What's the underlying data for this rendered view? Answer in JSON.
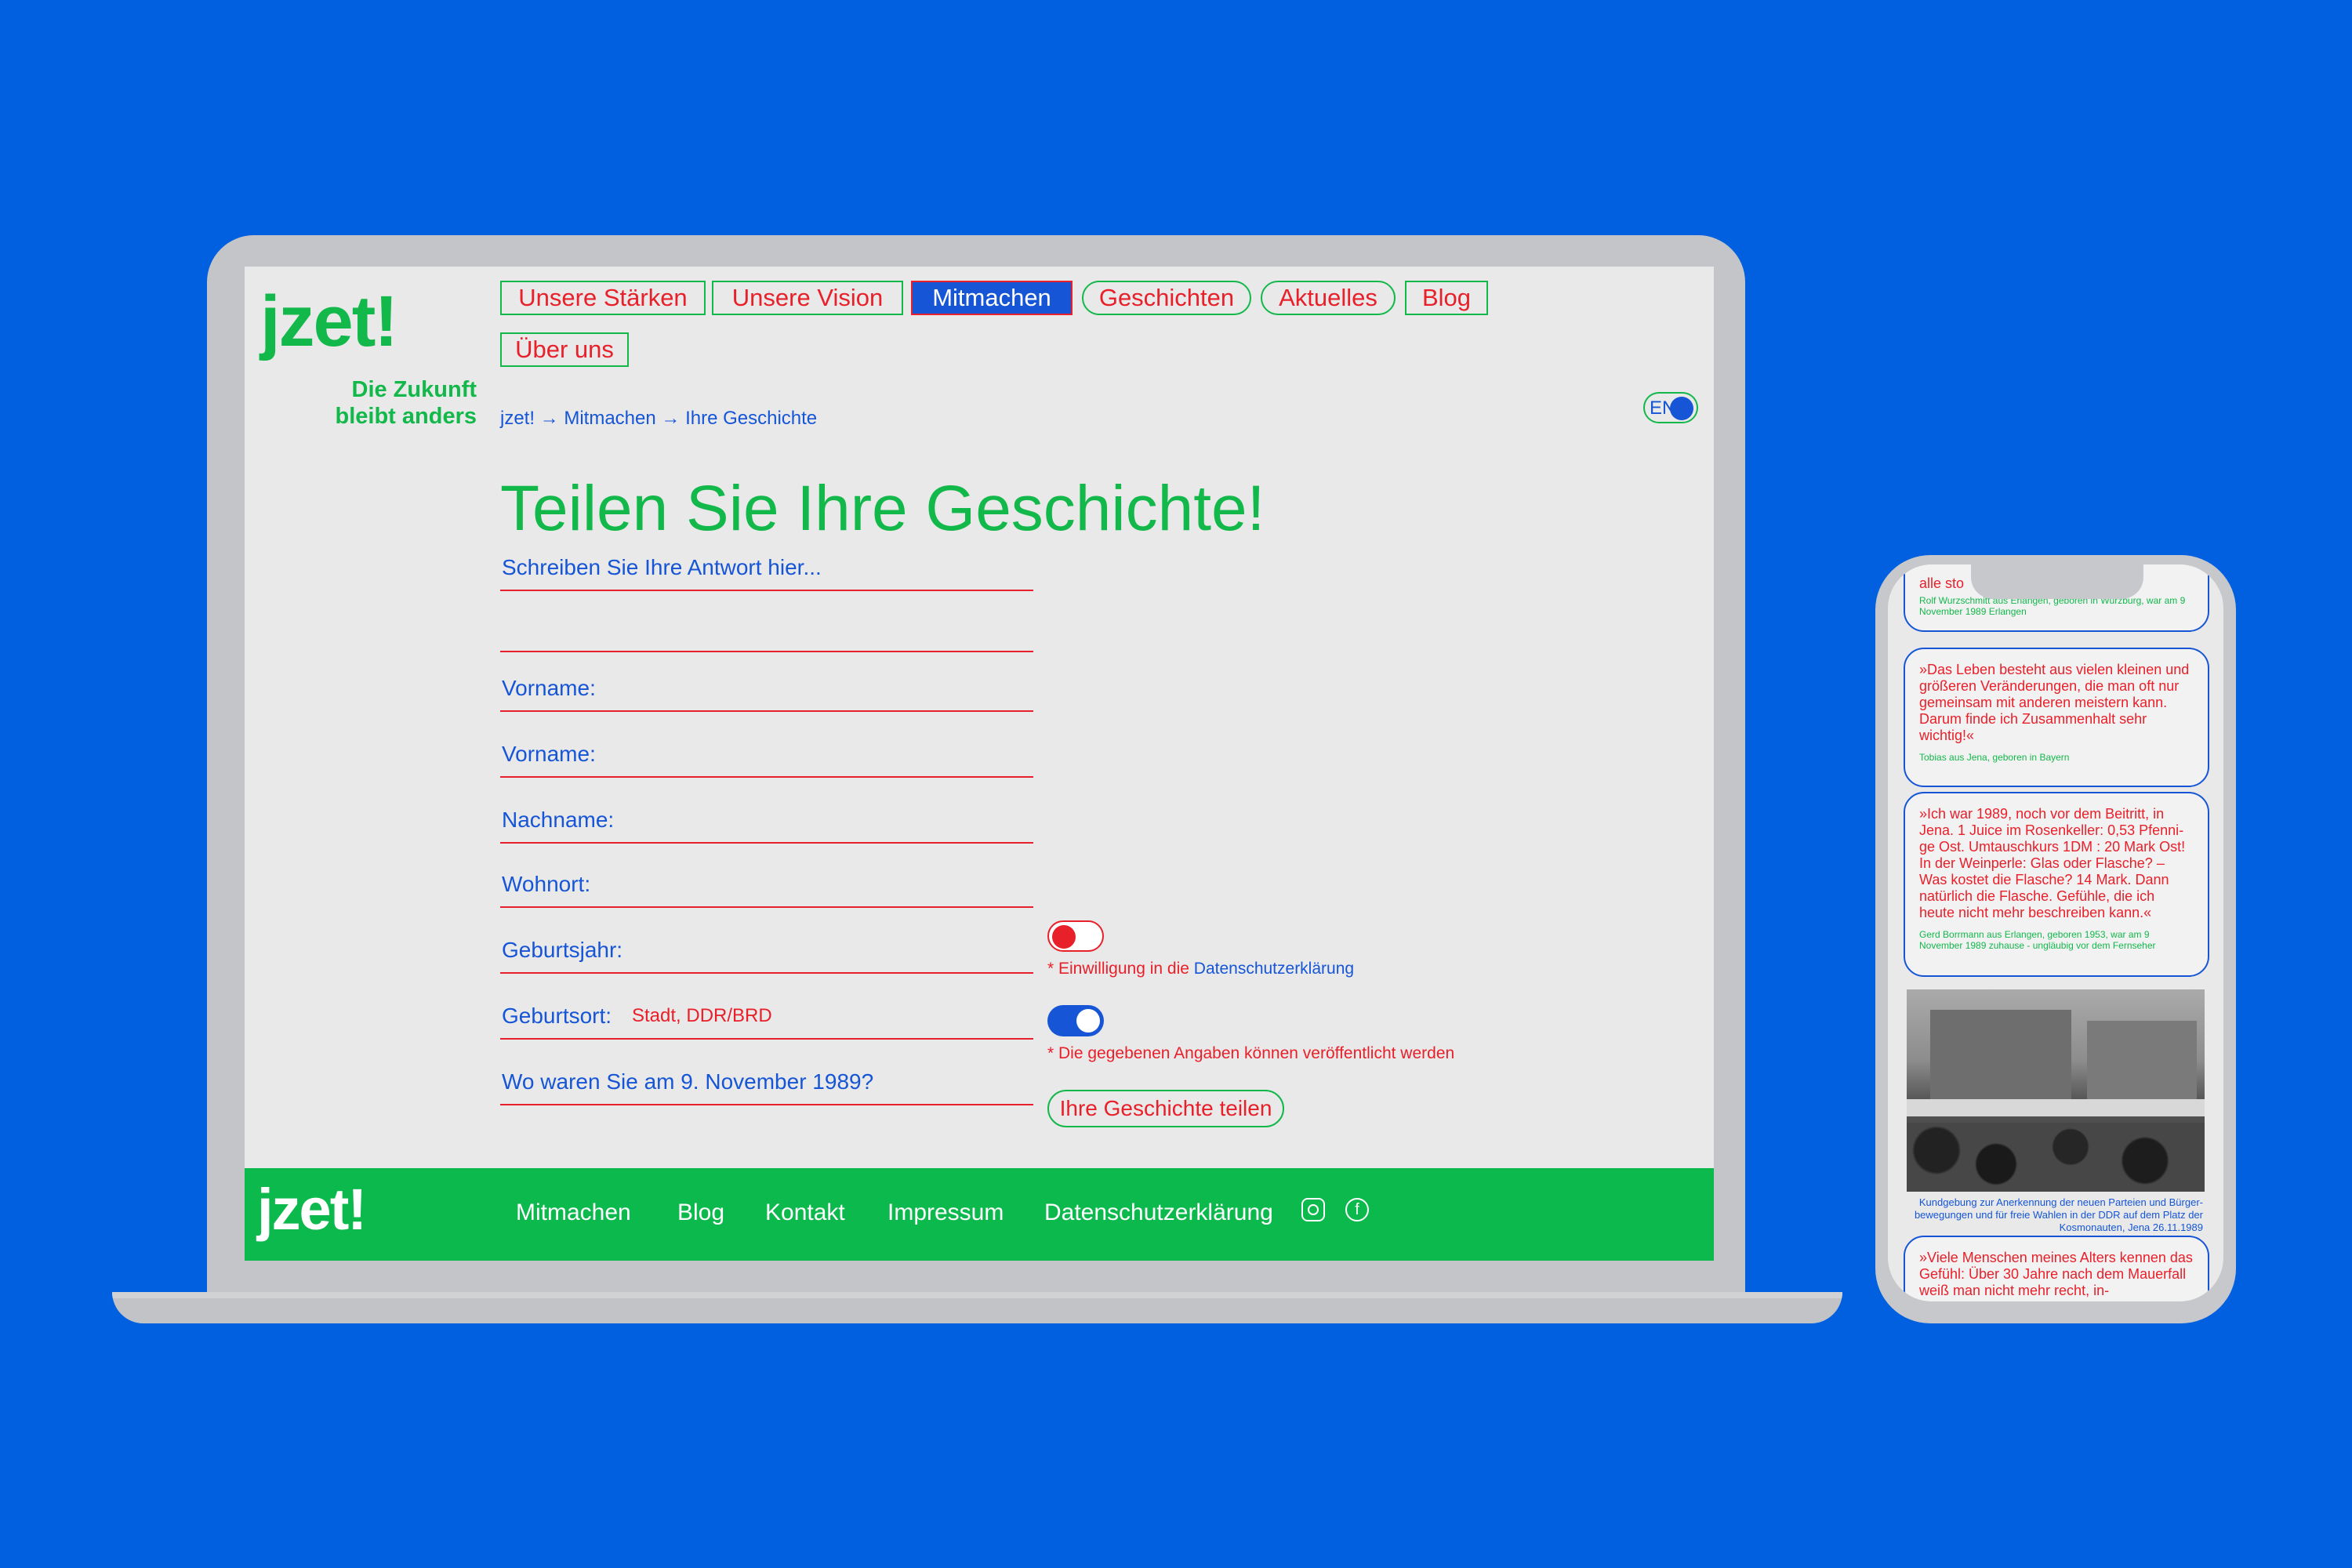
{
  "laptop": {
    "logo": "jzet!",
    "tagline_line1": "Die Zukunft",
    "tagline_line2": "bleibt anders",
    "nav": [
      {
        "label": "Unsere Stärken"
      },
      {
        "label": "Unsere Vision"
      },
      {
        "label": "Mitmachen",
        "active": true
      },
      {
        "label": "Geschichten"
      },
      {
        "label": "Aktuelles"
      },
      {
        "label": "Blog"
      },
      {
        "label": "Über uns"
      }
    ],
    "breadcrumb": "jzet! → Mitmachen → Ihre Geschichte",
    "lang": "EN",
    "headline": "Teilen Sie Ihre Geschichte!",
    "form": {
      "answer_placeholder": "Schreiben Sie Ihre Antwort hier...",
      "fields": [
        "Vorname:",
        "Vorname:",
        "Nachname:",
        "Wohnort:",
        "Geburtsjahr:",
        "Geburtsort:",
        "Wo waren Sie am 9. November 1989?"
      ],
      "birthplace_hint": "Stadt, DDR/BRD",
      "consent_prefix": "* Einwilligung in die ",
      "consent_link": "Datenschutzerklärung",
      "publish_note": "* Die gegebenen Angaben können veröffentlicht werden",
      "submit": "Ihre Geschichte teilen"
    },
    "footer": {
      "logo": "jzet!",
      "links": [
        "Mitmachen",
        "Blog",
        "Kontakt",
        "Impressum",
        "Datenschutzerklärung"
      ],
      "icons": [
        "instagram-icon",
        "facebook-icon"
      ]
    }
  },
  "phone": {
    "card0_quote": "alle sto",
    "card0_author": "Rolf Wurzschmitt aus Erlangen, geboren in Würzburg, war am 9 November 1989 Erlangen",
    "card1_quote": "»Das Leben besteht aus vielen kleinen und größeren Veränderungen, die man oft nur gemeinsam mit anderen meistern kann. Darum finde ich Zusammenhalt sehr wichtig!«",
    "card1_author": "Tobias aus Jena, geboren in Bayern",
    "card2_quote": "»Ich war 1989, noch vor dem Beitritt, in Jena. 1 Juice im Rosenkeller: 0,53 Pfenni­ge Ost. Umtauschkurs 1DM : 20 Mark Ost! In der Weinperle: Glas oder Flasche? – Was kostet die Flasche? 14 Mark. Dann natürlich die Flasche. Gefühle, die ich heute nicht mehr beschreiben kann.«",
    "card2_author": "Gerd Borrmann aus Erlangen, geboren 1953, war am 9 November 1989 zuhause - ungläubig vor dem Fernseher",
    "photo_caption": "Kundgebung zur Anerkennung der neuen Parteien und Bürger­bewegungen und für freie Wahlen in der DDR auf dem Platz der Kosmonauten, Jena 26.11.1989",
    "card3_quote": "»Viele Menschen meines Alters kennen das Gefühl: Über 30 Jahre nach dem Mauerfall weiß man nicht mehr recht, in-"
  },
  "colors": {
    "background": "#0060df",
    "green": "#12b84a",
    "red": "#e8202a",
    "blue": "#1555d6"
  }
}
